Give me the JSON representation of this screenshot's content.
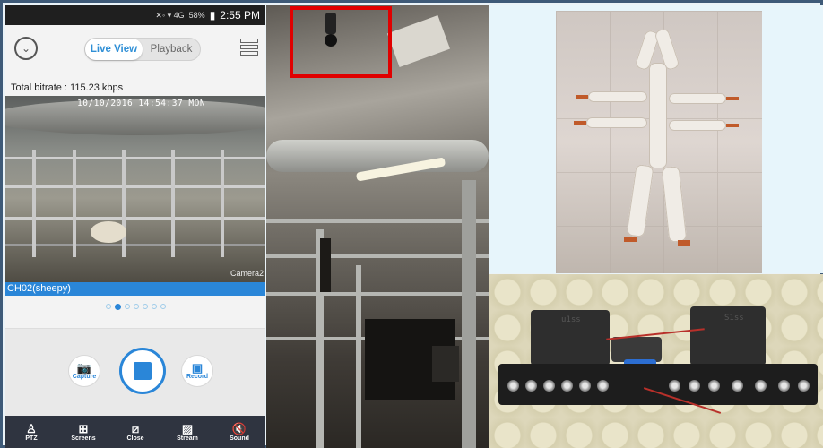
{
  "status_bar": {
    "icons_text": "✕◦ ▾ 4G",
    "battery": "58%",
    "time": "2:55 PM"
  },
  "app": {
    "tabs": [
      {
        "label": "Live View",
        "active": true
      },
      {
        "label": "Playback",
        "active": false
      }
    ],
    "bitrate": "Total bitrate : 115.23 kbps",
    "timestamp": "10/10/2016 14:54:37 MON",
    "camera_overlay": "Camera2",
    "channel_label": "CH02(sheepy)",
    "page_dots": 7,
    "active_dot": 1,
    "controls": {
      "capture": "Capture",
      "record": "Record"
    },
    "bottom_bar": [
      {
        "icon": "ptz-icon",
        "label": "PTZ"
      },
      {
        "icon": "screens-icon",
        "label": "Screens"
      },
      {
        "icon": "close-icon",
        "label": "Close"
      },
      {
        "icon": "stream-icon",
        "label": "Stream"
      },
      {
        "icon": "sound-icon",
        "label": "Sound"
      }
    ],
    "accent_color": "#2a86d8"
  },
  "pcb": {
    "label_left": "u1ss",
    "label_right": "S1ss"
  }
}
